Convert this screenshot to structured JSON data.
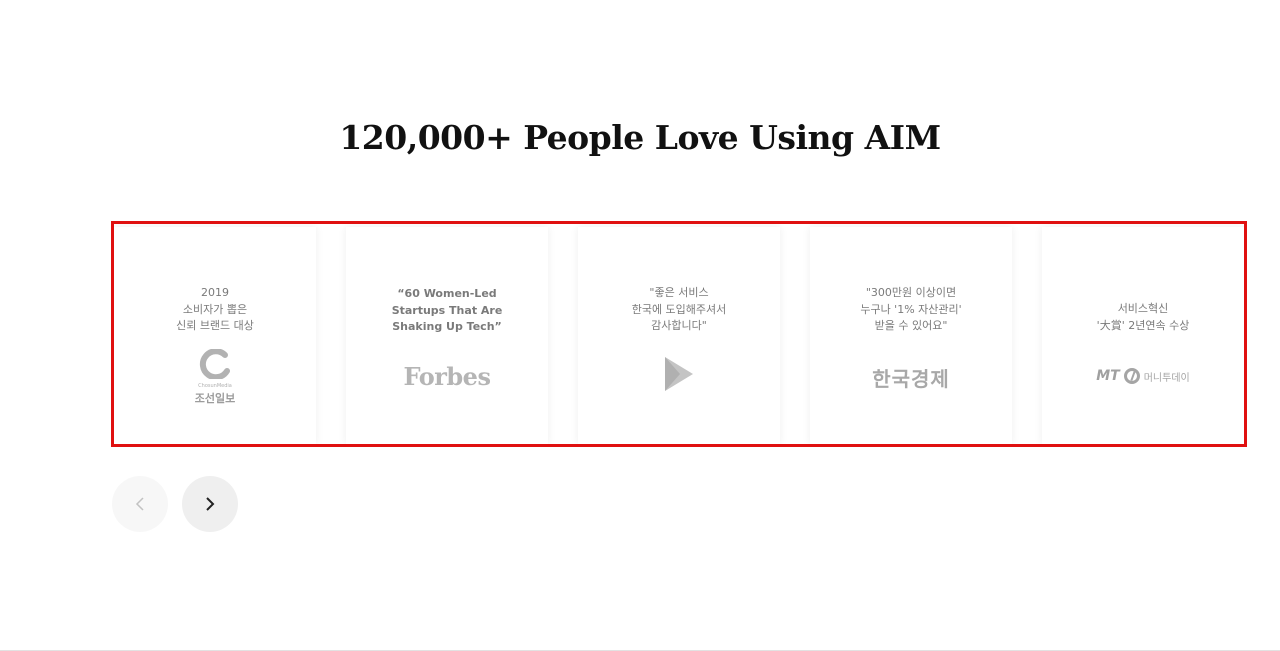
{
  "section": {
    "title": "120,000+ People Love Using AIM"
  },
  "cards": [
    {
      "text": "2019\n소비자가 뽑은\n신뢰 브랜드 대상",
      "logo_sub": "조선일보",
      "logo_small": "ChosunMedia",
      "logo_icon": "chosun-media-logo-icon"
    },
    {
      "text": "“60 Women-Led\nStartups That Are\nShaking Up Tech”",
      "logo": "Forbes"
    },
    {
      "text": "\"좋은 서비스\n한국에 도입해주셔서\n감사합니다\"",
      "logo_icon": "google-play-icon"
    },
    {
      "text": "\"300만원 이상이면\n누구나 '1% 자산관리'\n받을 수 있어요\"",
      "logo": "한국경제"
    },
    {
      "text": "서비스혁신\n'大賞' 2년연속 수상",
      "logo": "MT",
      "logo_sub": "머니투데이",
      "logo_icon": "money-today-logo-icon"
    }
  ],
  "nav": {
    "prev_icon": "chevron-left-icon",
    "next_icon": "chevron-right-icon"
  },
  "colors": {
    "highlight_border": "#e01010",
    "title": "#111111",
    "card_text": "#7a7a7a"
  }
}
